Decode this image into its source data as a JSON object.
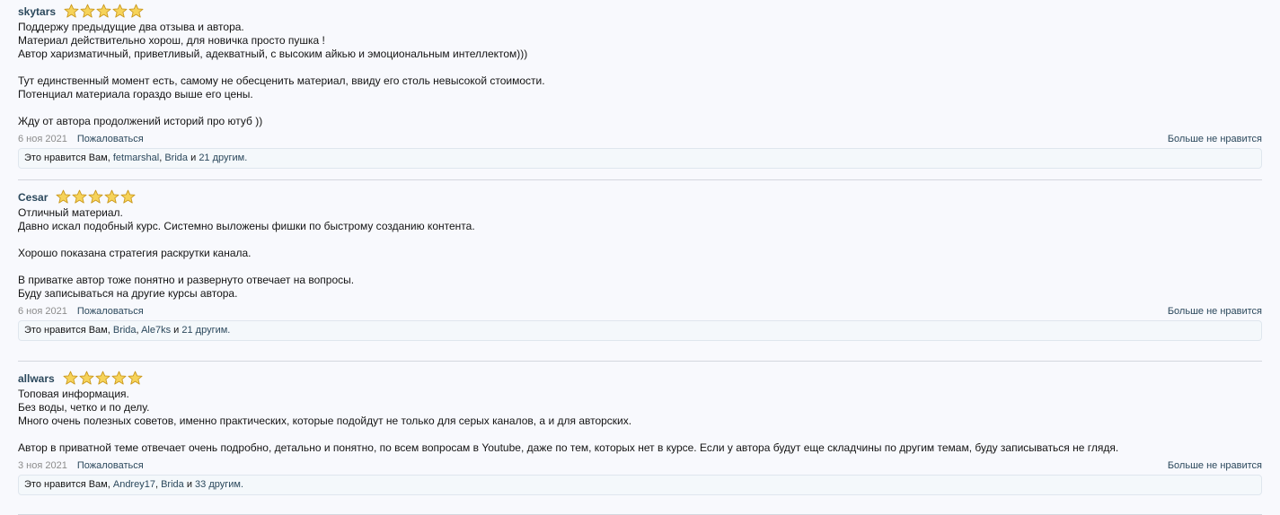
{
  "reviews": [
    {
      "author": "skytars",
      "rating": 5,
      "text": "Поддержу предыдущие два отзыва и автора.\nМатериал действительно хорош, для новичка просто пушка !\nАвтор харизматичный, приветливый, адекватный, с высоким айкью и эмоциональным интеллектом)))\n\nТут единственный момент есть, самому не обесценить материал, ввиду его столь невысокой стоимости.\nПотенциал материала гораздо выше его цены.\n\nЖду от автора продолжений историй про ютуб ))",
      "date": "6 ноя 2021",
      "report": "Пожаловаться",
      "unlike": "Больше не нравится",
      "likes": {
        "prefix": "Это нравится Вам,",
        "user1": "fetmarshal",
        "sep": ",",
        "user2": "Brida",
        "and": "и",
        "others": "21 другим."
      }
    },
    {
      "author": "Cesar",
      "rating": 5,
      "text": "Отличный материал.\nДавно искал подобный курс. Системно выложены фишки по быстрому созданию контента.\n\nХорошо показана стратегия раскрутки канала.\n\nВ приватке автор тоже понятно и развернуто отвечает на вопросы.\nБуду записываться на другие курсы автора.",
      "date": "6 ноя 2021",
      "report": "Пожаловаться",
      "unlike": "Больше не нравится",
      "likes": {
        "prefix": "Это нравится Вам,",
        "user1": "Brida",
        "sep": ",",
        "user2": "Ale7ks",
        "and": "и",
        "others": "21 другим."
      }
    },
    {
      "author": "allwars",
      "rating": 5,
      "text": "Топовая информация.\nБез воды, четко и по делу.\nМного очень полезных советов, именно практических, которые подойдут не только для серых каналов, а и для авторских.\n\nАвтор в приватной теме отвечает очень подробно, детально и понятно, по всем вопросам в Youtube, даже по тем, которых нет в курсе. Если у автора будут еще складчины по другим темам, буду записываться не глядя.",
      "date": "3 ноя 2021",
      "report": "Пожаловаться",
      "unlike": "Больше не нравится",
      "likes": {
        "prefix": "Это нравится Вам,",
        "user1": "Andrey17",
        "sep": ",",
        "user2": "Brida",
        "and": "и",
        "others": "33 другим."
      }
    }
  ],
  "colors": {
    "star_fill": "#f6d35a",
    "star_stroke": "#c9961a",
    "link": "#2b485c"
  },
  "icons": {
    "star": "star-icon"
  }
}
